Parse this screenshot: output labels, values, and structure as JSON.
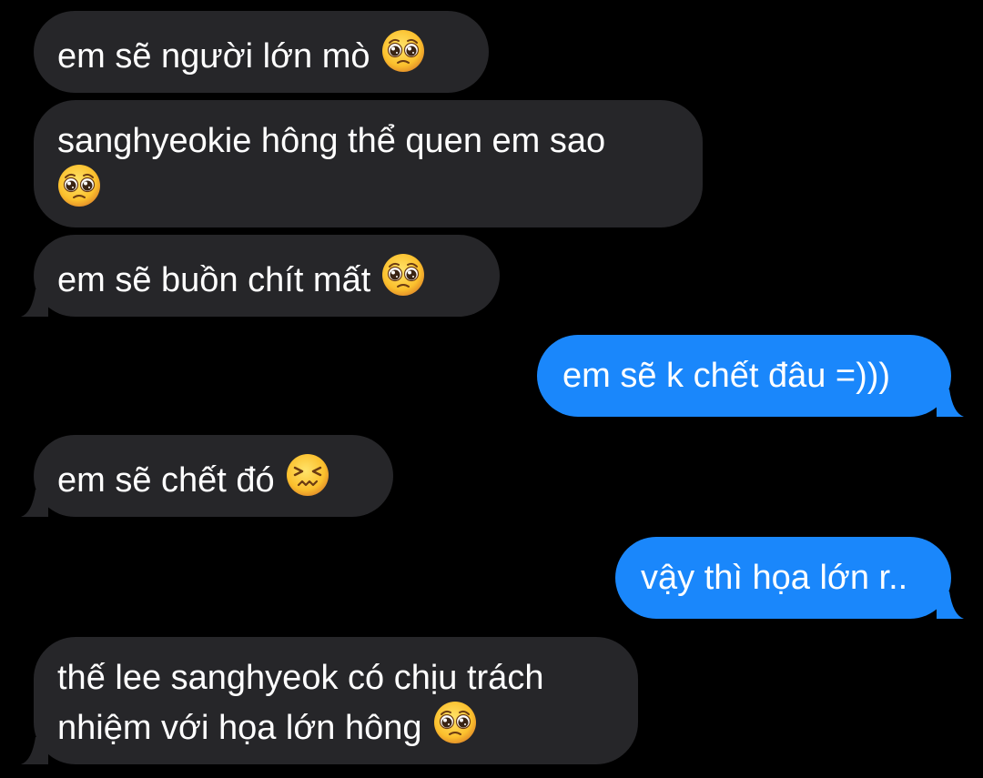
{
  "colors": {
    "background": "#000000",
    "incoming_bubble": "#262629",
    "outgoing_bubble": "#1a87fb",
    "text": "#ffffff"
  },
  "messages": [
    {
      "direction": "incoming",
      "text": "em sẽ người lớn mò",
      "emoji": "pleading-face-icon"
    },
    {
      "direction": "incoming",
      "text": "sanghyeokie hông thể quen em sao",
      "emoji": "pleading-face-icon"
    },
    {
      "direction": "incoming",
      "text": "em sẽ buồn chít mất",
      "emoji": "pleading-face-icon"
    },
    {
      "direction": "outgoing",
      "text": "em sẽ k chết đâu =)))"
    },
    {
      "direction": "incoming",
      "text": "em sẽ chết đó",
      "emoji": "confounded-face-icon"
    },
    {
      "direction": "outgoing",
      "text": "vậy thì họa lớn r.."
    },
    {
      "direction": "incoming",
      "text_line1": "thế lee sanghyeok có chịu trách",
      "text_line2": "nhiệm với họa lớn hông",
      "emoji": "pleading-face-icon"
    }
  ]
}
